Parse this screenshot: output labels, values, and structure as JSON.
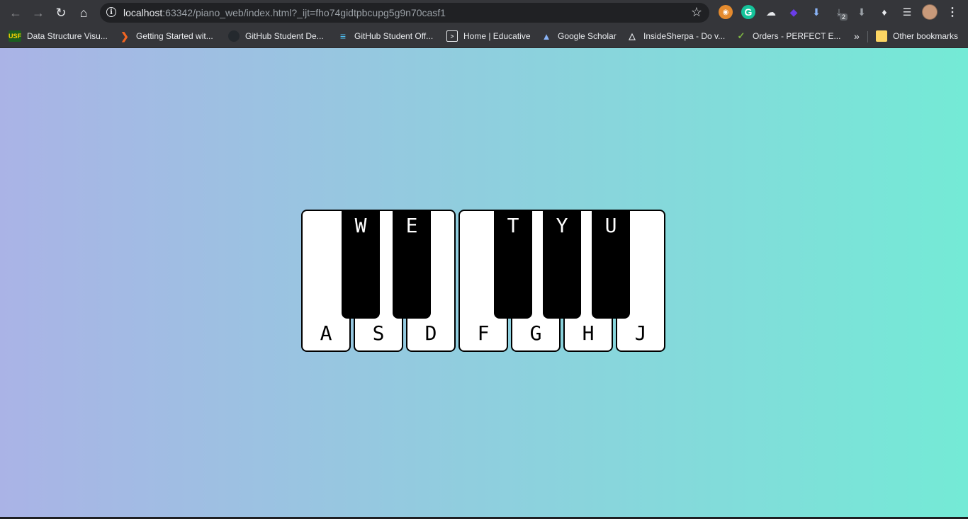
{
  "browser": {
    "url_host": "localhost",
    "url_rest": ":63342/piano_web/index.html?_ijt=fho74gidtpbcupg5g9n70casf1",
    "bookmarks": [
      "Data Structure Visu...",
      "Getting Started wit...",
      "GitHub Student De...",
      "GitHub Student Off...",
      "Home | Educative",
      "Google Scholar",
      "InsideSherpa - Do v...",
      "Orders - PERFECT E..."
    ],
    "overflow": "»",
    "other_bookmarks": "Other bookmarks",
    "download_badge": "2",
    "usf_icon_text": "USF"
  },
  "piano": {
    "white_keys": [
      "A",
      "S",
      "D",
      "F",
      "G",
      "H",
      "J"
    ],
    "black_keys": [
      "W",
      "E",
      "T",
      "Y",
      "U"
    ]
  },
  "colors": {
    "gradient_start": "#aab3e6",
    "gradient_end": "#74ead6",
    "white_key": "#ffffff",
    "black_key": "#000000",
    "chrome_bg": "#35363a"
  }
}
